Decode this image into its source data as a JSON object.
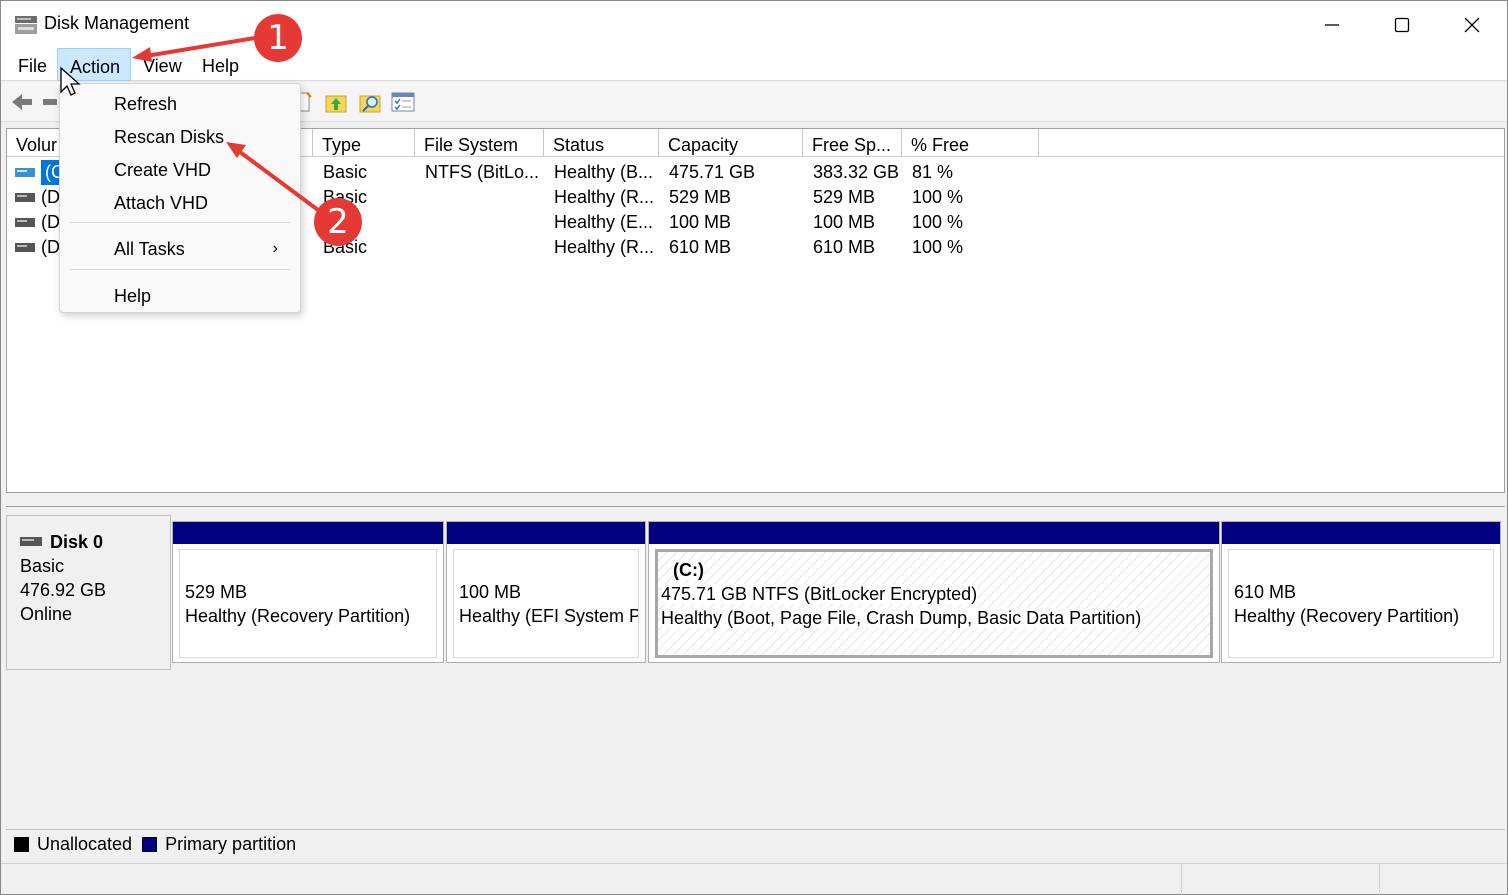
{
  "window": {
    "title": "Disk Management",
    "icon": "disk-management-icon"
  },
  "menubar": {
    "items": [
      "File",
      "Action",
      "View",
      "Help"
    ]
  },
  "action_menu": {
    "refresh": "Refresh",
    "rescan": "Rescan Disks",
    "create_vhd": "Create VHD",
    "attach_vhd": "Attach VHD",
    "all_tasks": "All Tasks",
    "all_tasks_arrow": "›",
    "help": "Help"
  },
  "volume_list": {
    "columns": [
      "Volur",
      "Type",
      "File System",
      "Status",
      "Capacity",
      "Free Sp...",
      "% Free"
    ],
    "rows": [
      {
        "volume": "(C",
        "type": "Basic",
        "fs": "NTFS (BitLo...",
        "status": "Healthy (B...",
        "capacity": "475.71 GB",
        "free": "383.32 GB",
        "pct": "81 %"
      },
      {
        "volume": "(Di",
        "type": "Basic",
        "fs": "",
        "status": "Healthy (R...",
        "capacity": "529 MB",
        "free": "529 MB",
        "pct": "100 %"
      },
      {
        "volume": "(Di",
        "type": "",
        "fs": "",
        "status": "Healthy (E...",
        "capacity": "100 MB",
        "free": "100 MB",
        "pct": "100 %"
      },
      {
        "volume": "(Di",
        "type": "Basic",
        "fs": "",
        "status": "Healthy (R...",
        "capacity": "610 MB",
        "free": "610 MB",
        "pct": "100 %"
      }
    ]
  },
  "disk0": {
    "name": "Disk 0",
    "type": "Basic",
    "size": "476.92 GB",
    "state": "Online",
    "partitions": [
      {
        "label": "",
        "size": "529 MB",
        "status": "Healthy (Recovery Partition)"
      },
      {
        "label": "",
        "size": "100 MB",
        "status": "Healthy (EFI System Pa"
      },
      {
        "label": "(C:)",
        "size": "475.71 GB NTFS (BitLocker Encrypted)",
        "status": "Healthy (Boot, Page File, Crash Dump, Basic Data Partition)"
      },
      {
        "label": "",
        "size": "610 MB",
        "status": "Healthy (Recovery Partition)"
      }
    ]
  },
  "legend": {
    "unallocated": "Unallocated",
    "primary": "Primary partition"
  },
  "annotations": {
    "step1": "1",
    "step2": "2"
  },
  "colors": {
    "primary_partition": "#000080",
    "selection": "#0078d7",
    "annotation": "#e53935",
    "menu_highlight": "#cce8ff"
  }
}
